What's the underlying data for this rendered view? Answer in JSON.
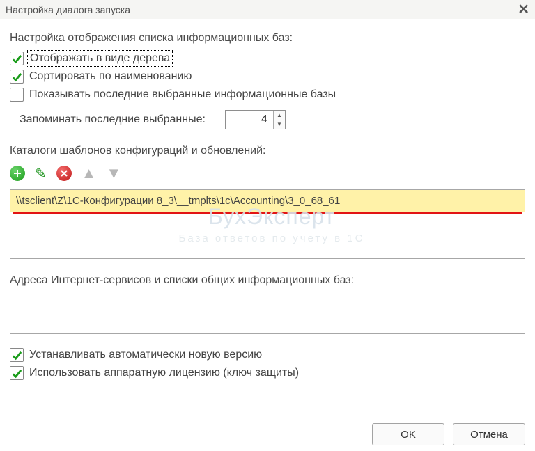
{
  "title": "Настройка диалога запуска",
  "display_heading": "Настройка отображения списка информационных баз:",
  "checks": {
    "tree_view": {
      "label": "Отображать в виде дерева",
      "checked": true
    },
    "sort_name": {
      "label": "Сортировать по наименованию",
      "checked": true
    },
    "show_recent": {
      "label": "Показывать последние выбранные информационные базы",
      "checked": false
    }
  },
  "remember": {
    "label": "Запоминать последние выбранные:",
    "value": "4"
  },
  "templates_heading": "Каталоги шаблонов конфигураций и обновлений:",
  "toolbar_icons": {
    "add": "plus-icon",
    "edit": "pencil-icon",
    "del": "x-icon",
    "up": "arrow-up-icon",
    "down": "arrow-down-icon"
  },
  "template_list": {
    "selected": "\\\\tsclient\\Z\\1С-Конфигурации 8_3\\__tmplts\\1c\\Accounting\\3_0_68_61"
  },
  "internet_heading": "Адреса Интернет-сервисов и списки общих информационных баз:",
  "checks2": {
    "auto_update": {
      "label": "Устанавливать автоматически новую версию",
      "checked": true
    },
    "hw_license": {
      "label": "Использовать аппаратную лицензию (ключ защиты)",
      "checked": true
    }
  },
  "buttons": {
    "ok": "OK",
    "cancel": "Отмена"
  },
  "watermark": {
    "main": "БухЭксперт",
    "sub": "База ответов по учету в 1С"
  }
}
